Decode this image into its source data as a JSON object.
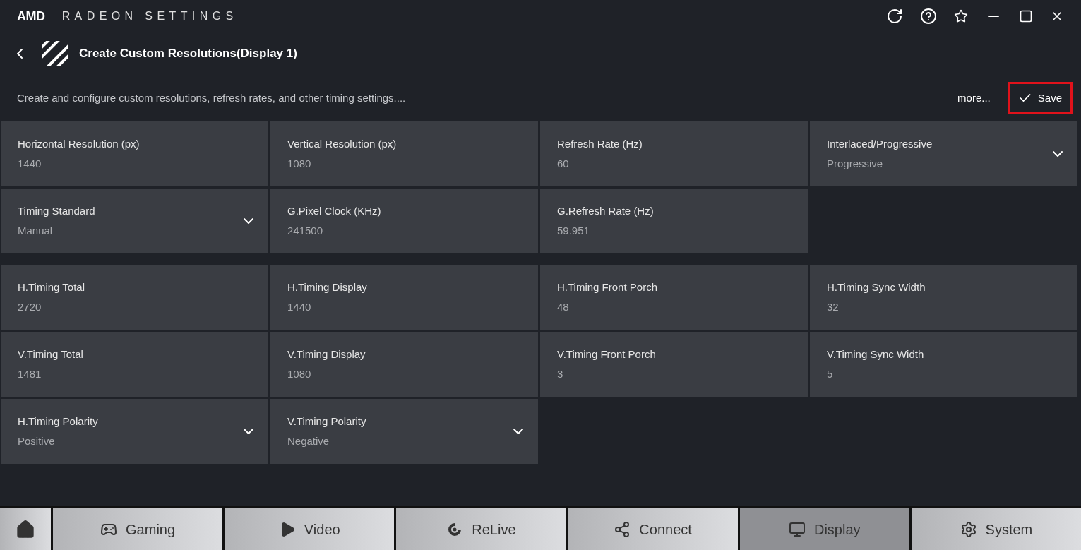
{
  "app": {
    "brand": "AMD",
    "title": "RADEON SETTINGS"
  },
  "page": {
    "title": "Create Custom Resolutions(Display 1)",
    "description": "Create and configure custom resolutions, refresh rates, and other timing settings....",
    "more": "more...",
    "save": "Save",
    "save_highlighted": true
  },
  "groups": [
    {
      "tiles": [
        {
          "label": "Horizontal Resolution (px)",
          "value": "1440",
          "dropdown": false
        },
        {
          "label": "Vertical Resolution (px)",
          "value": "1080",
          "dropdown": false
        },
        {
          "label": "Refresh Rate (Hz)",
          "value": "60",
          "dropdown": false
        },
        {
          "label": "Interlaced/Progressive",
          "value": "Progressive",
          "dropdown": true
        },
        {
          "label": "Timing Standard",
          "value": "Manual",
          "dropdown": true
        },
        {
          "label": "G.Pixel Clock (KHz)",
          "value": "241500",
          "dropdown": false
        },
        {
          "label": "G.Refresh Rate (Hz)",
          "value": "59.951",
          "dropdown": false
        }
      ]
    },
    {
      "tiles": [
        {
          "label": "H.Timing Total",
          "value": "2720",
          "dropdown": false
        },
        {
          "label": "H.Timing Display",
          "value": "1440",
          "dropdown": false
        },
        {
          "label": "H.Timing Front Porch",
          "value": "48",
          "dropdown": false
        },
        {
          "label": "H.Timing Sync Width",
          "value": "32",
          "dropdown": false
        },
        {
          "label": "V.Timing Total",
          "value": "1481",
          "dropdown": false
        },
        {
          "label": "V.Timing Display",
          "value": "1080",
          "dropdown": false
        },
        {
          "label": "V.Timing Front Porch",
          "value": "3",
          "dropdown": false
        },
        {
          "label": "V.Timing Sync Width",
          "value": "5",
          "dropdown": false
        },
        {
          "label": "H.Timing Polarity",
          "value": "Positive",
          "dropdown": true
        },
        {
          "label": "V.Timing Polarity",
          "value": "Negative",
          "dropdown": true
        }
      ]
    }
  ],
  "nav": [
    {
      "kind": "home",
      "selected": false
    },
    {
      "kind": "gaming",
      "label": "Gaming",
      "selected": false
    },
    {
      "kind": "video",
      "label": "Video",
      "selected": false
    },
    {
      "kind": "relive",
      "label": "ReLive",
      "selected": false
    },
    {
      "kind": "connect",
      "label": "Connect",
      "selected": false
    },
    {
      "kind": "display",
      "label": "Display",
      "selected": true
    },
    {
      "kind": "system",
      "label": "System",
      "selected": false
    }
  ]
}
